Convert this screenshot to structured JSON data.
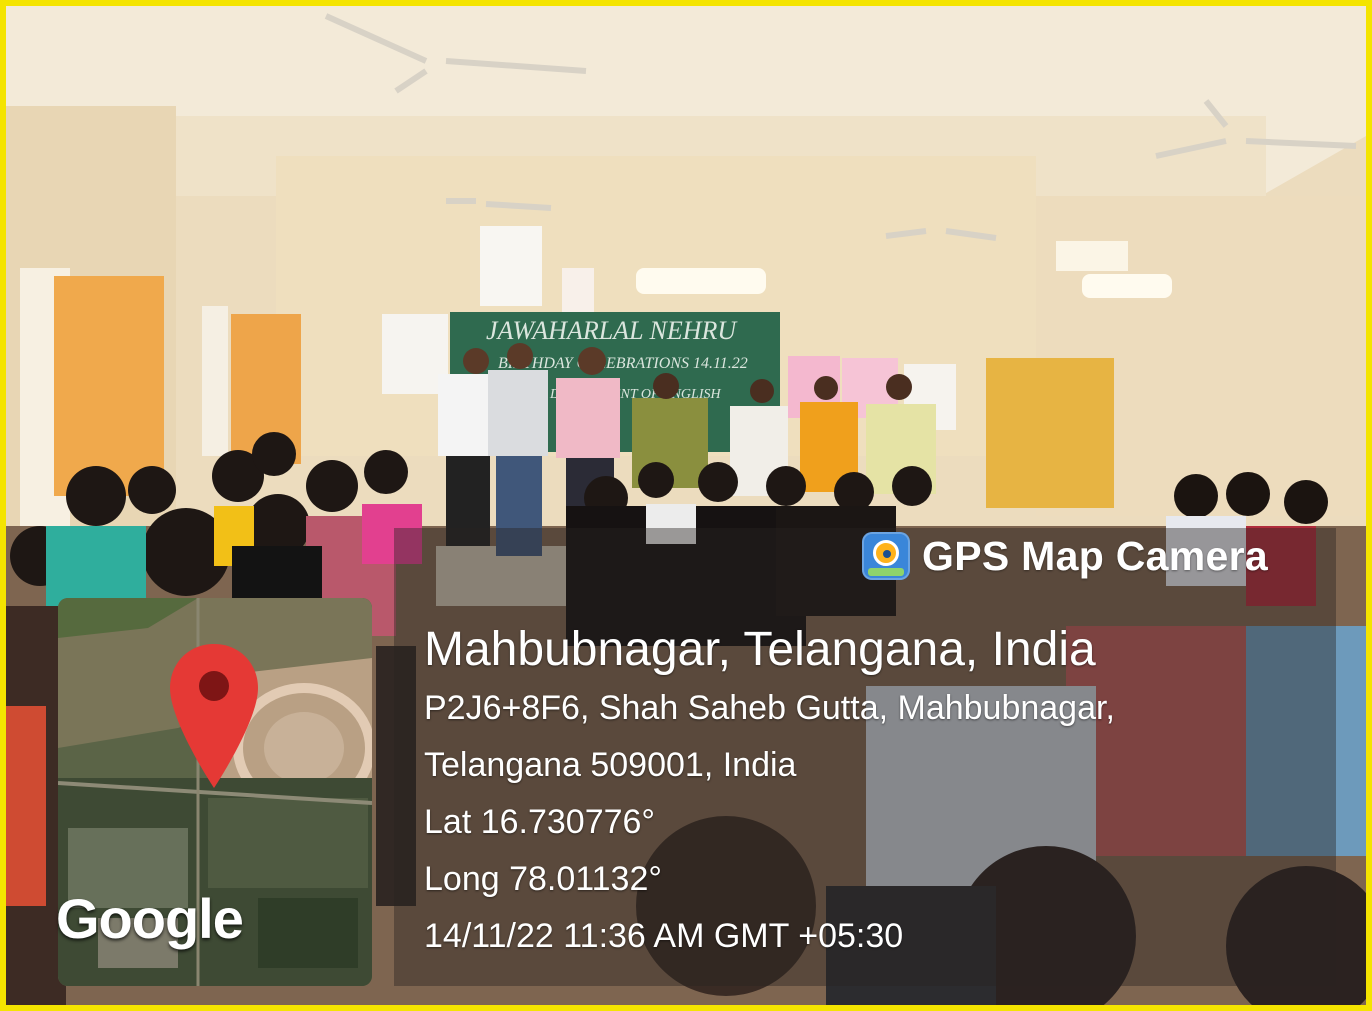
{
  "brand": {
    "name": "GPS Map Camera",
    "icon": "map-camera-icon"
  },
  "location": {
    "title": "Mahbubnagar, Telangana, India",
    "address_line1": "P2J6+8F6, Shah Saheb Gutta, Mahbubnagar,",
    "address_line2": "Telangana 509001, India",
    "latitude": "Lat 16.730776°",
    "longitude": "Long 78.01132°",
    "timestamp": "14/11/22 11:36 AM GMT +05:30"
  },
  "map": {
    "provider": "Google",
    "pin_icon": "map-pin-icon"
  },
  "photo": {
    "blackboard_text": [
      "JAWAHARLAL NEHRU",
      "BIRTHDAY CELEBRATIONS",
      "DEPARTMENT OF ENGLISH",
      "14.11.22"
    ]
  },
  "colors": {
    "frame": "#f4e400",
    "pin": "#e53935"
  }
}
